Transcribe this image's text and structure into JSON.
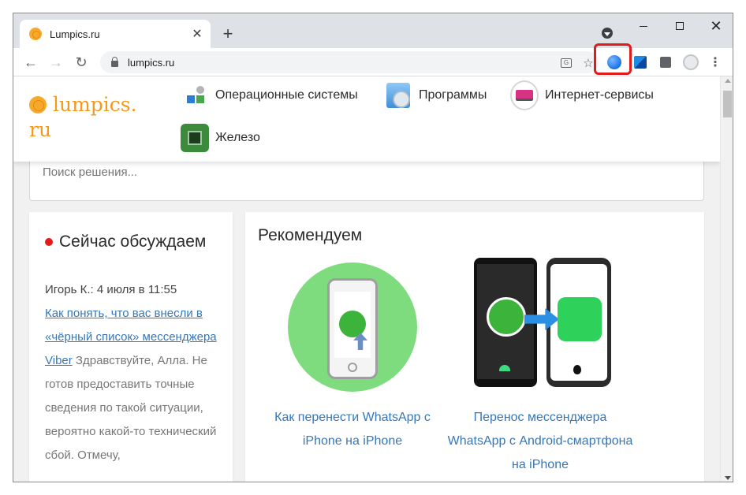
{
  "browser": {
    "tab_title": "Lumpics.ru",
    "tab_close": "✕",
    "new_tab": "+",
    "url": "lumpics.ru",
    "back": "←",
    "forward": "→",
    "reload": "↻",
    "star": "☆",
    "translate_glyph": "G",
    "menu": "⋮",
    "close_window": "✕",
    "highlight_color": "#e01b1b"
  },
  "site": {
    "logo_line1": "lumpics.",
    "logo_line2": "ru",
    "accent": "#f29a1f",
    "menu": [
      {
        "label": "Операционные системы",
        "icon": "windows-os-icon"
      },
      {
        "label": "Программы",
        "icon": "software-disc-icon"
      },
      {
        "label": "Интернет-сервисы",
        "icon": "laptop-web-icon"
      },
      {
        "label": "Железо",
        "icon": "motherboard-icon"
      }
    ],
    "search_placeholder": "Поиск решения..."
  },
  "discussion": {
    "title": "Сейчас обсуждаем",
    "author_meta": "Игорь К.: 4 июля в 11:55",
    "link": "Как понять, что вас внесли в «чёрный список» мессенджера Viber",
    "text": "Здравствуйте, Алла. Не готов предоставить точные сведения по такой ситуации, вероятно какой-то технический сбой. Отмечу,"
  },
  "recommend": {
    "title": "Рекомендуем",
    "cards": [
      {
        "title": "Как перенести WhatsApp с iPhone на iPhone"
      },
      {
        "title": "Перенос мессенджера WhatsApp с Android-смартфона на iPhone"
      }
    ]
  }
}
